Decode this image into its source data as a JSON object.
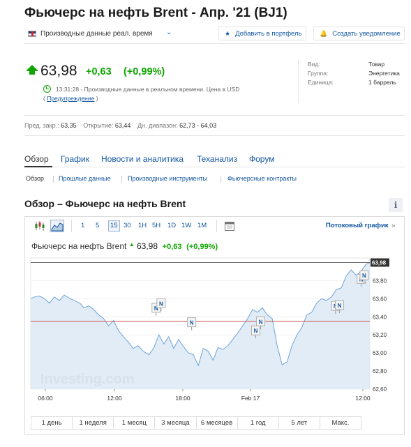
{
  "page": {
    "title": "Фьючерс на нефть Brent - Апр. '21 (BJ1)",
    "realtime_label": "Производные данные реал. время",
    "add_portfolio": "Добавить в портфель",
    "create_alert": "Создать уведомление"
  },
  "quote": {
    "price": "63,98",
    "change": "+0,63",
    "change_pct": "(+0,99%)",
    "time_note": "13:31:28 - Производные данные в реальном времени. Цена в USD",
    "warning_open": "(",
    "warning_link": "Предупреждение",
    "warning_close": ")"
  },
  "instrument": {
    "type_label": "Вид:",
    "type_value": "Товар",
    "group_label": "Группа:",
    "group_value": "Энергетика",
    "unit_label": "Единица:",
    "unit_value": "1 баррель"
  },
  "stats": {
    "prev_close_label": "Пред. закр.:",
    "prev_close": "63,35",
    "open_label": "Открытие:",
    "open": "63,44",
    "day_range_label": "Дн. диапазон:",
    "day_range": "62,73 - 64,03"
  },
  "tabs": [
    "Обзор",
    "График",
    "Новости и аналитика",
    "Теханализ",
    "Форум"
  ],
  "subtabs": [
    "Обзор",
    "Прошлые данные",
    "Производные инструменты",
    "Фьючерсные контракты"
  ],
  "section": {
    "title": "Обзор – Фьючерс на нефть Brent",
    "info_icon": "i"
  },
  "toolbar": {
    "candle_icon": "candlestick-icon",
    "area_icon": "area-chart-icon",
    "intervals": [
      "1",
      "5",
      "15",
      "30",
      "1H",
      "5H",
      "1D",
      "1W",
      "1M"
    ],
    "active_interval": "15",
    "calendar_icon": "calendar-icon",
    "stream_label": "Потоковый график",
    "stream_arrow": "»"
  },
  "chart_header": {
    "name": "Фьючерс на нефть Brent",
    "price": "63,98",
    "change": "+0,63",
    "change_pct": "(+0,99%)"
  },
  "periods": [
    "1 день",
    "1 неделя",
    "1 месяц",
    "3 месяца",
    "6 месяцев",
    "1 год",
    "5 лет",
    "Макс."
  ],
  "chart_data": {
    "type": "area",
    "title": "",
    "xlabel": "",
    "ylabel": "",
    "x_ticks": [
      "06:00",
      "12:00",
      "18:00",
      "Feb 17",
      "12:00"
    ],
    "y_ticks": [
      "62,60",
      "62,80",
      "63,00",
      "63,20",
      "63,40",
      "63,60",
      "63,80"
    ],
    "ylim": [
      62.6,
      64.05
    ],
    "last_label": "63,98",
    "prev_close_line": 63.35,
    "high_line": 64.0,
    "watermark": "Investing.com",
    "news_marker_label": "N",
    "news_markers": [
      {
        "x": 6.15,
        "y": 63.55
      },
      {
        "x": 6.4,
        "y": 63.6
      },
      {
        "x": 7.95,
        "y": 63.39
      },
      {
        "x": 11.2,
        "y": 63.3
      },
      {
        "x": 11.45,
        "y": 63.4
      },
      {
        "x": 15.25,
        "y": 63.57
      },
      {
        "x": 15.45,
        "y": 63.58
      },
      {
        "x": 16.55,
        "y": 63.87
      },
      {
        "x": 16.7,
        "y": 63.91
      }
    ],
    "series": [
      {
        "x": [
          0,
          0.2,
          0.45,
          0.7,
          0.95,
          1.2,
          1.45,
          1.7,
          2.0,
          2.3,
          2.5,
          2.7,
          2.95,
          3.2,
          3.45,
          3.7,
          3.95,
          4.2,
          4.45,
          4.7,
          4.95,
          5.2,
          5.45,
          5.7,
          6.0,
          6.25,
          6.5,
          6.75,
          7.0,
          7.25,
          7.5,
          7.75,
          8.0,
          8.25,
          8.5,
          8.75,
          9.0,
          9.25,
          9.5,
          9.75,
          10.0,
          10.25,
          10.5,
          10.75,
          11.0,
          11.25,
          11.5,
          11.75,
          12.0,
          12.25,
          12.5,
          12.75,
          13.0,
          13.25,
          13.5,
          13.75,
          14.0,
          14.25,
          14.5,
          14.75,
          15.0,
          15.25,
          15.5,
          15.75,
          16.0,
          16.25,
          16.5,
          16.75,
          17.0,
          17.2
        ],
        "values": [
          63.6,
          63.62,
          63.63,
          63.6,
          63.55,
          63.62,
          63.58,
          63.64,
          63.6,
          63.57,
          63.55,
          63.5,
          63.52,
          63.48,
          63.42,
          63.38,
          63.3,
          63.36,
          63.25,
          63.18,
          63.12,
          63.05,
          63.08,
          63.02,
          62.98,
          63.06,
          63.2,
          63.1,
          63.18,
          63.05,
          63.15,
          63.07,
          63.0,
          62.98,
          62.86,
          63.05,
          63.02,
          62.92,
          63.06,
          63.04,
          63.08,
          63.15,
          63.22,
          63.3,
          63.38,
          63.48,
          63.45,
          63.5,
          63.42,
          63.38,
          63.08,
          62.87,
          62.9,
          63.08,
          63.2,
          63.28,
          63.42,
          63.45,
          63.55,
          63.6,
          63.58,
          63.62,
          63.7,
          63.72,
          63.85,
          63.92,
          63.86,
          63.9,
          63.98,
          64.0
        ]
      }
    ]
  }
}
